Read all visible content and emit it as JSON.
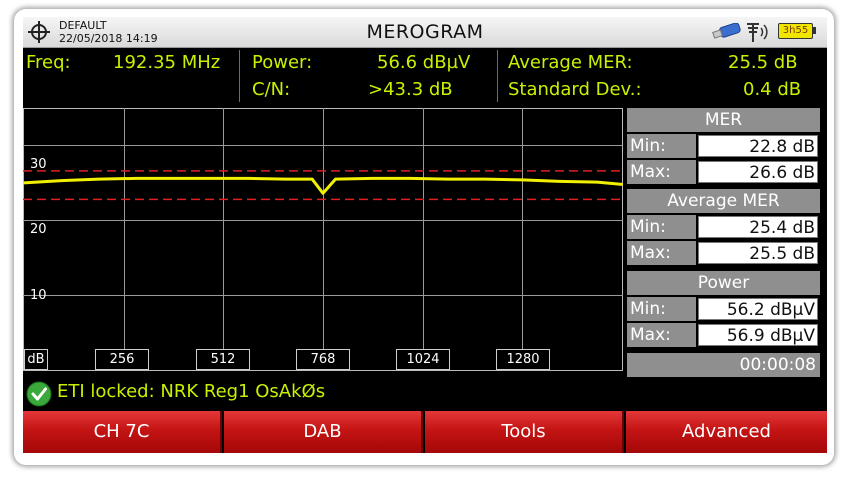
{
  "header": {
    "profile": "DEFAULT",
    "datetime": "22/05/2018 14:19",
    "title": "MEROGRAM",
    "battery_label": "3h55",
    "icons": [
      "crosshair-icon",
      "usb-icon",
      "antenna-signal-icon",
      "battery-icon"
    ]
  },
  "readouts": {
    "freq_label": "Freq:",
    "freq_value": "192.35 MHz",
    "power_label": "Power:",
    "power_value": "56.6 dBµV",
    "cn_label": "C/N:",
    "cn_value": ">43.3 dB",
    "avg_mer_label": "Average MER:",
    "avg_mer_value": "25.5 dB",
    "std_dev_label": "Standard Dev.:",
    "std_dev_value": "0.4 dB"
  },
  "chart_data": {
    "type": "line",
    "title": "",
    "xlabel": "",
    "ylabel": "dB",
    "x_ticks": [
      "256",
      "512",
      "768",
      "1024",
      "1280"
    ],
    "y_ticks": [
      "30",
      "20",
      "10"
    ],
    "y_unit_label": "dB",
    "xlim": [
      0,
      1536
    ],
    "ylim": [
      0,
      35
    ],
    "grid": true,
    "series": [
      {
        "color": "#f0f000",
        "x": [
          0,
          96,
          192,
          288,
          384,
          480,
          576,
          672,
          740,
          768,
          800,
          896,
          992,
          1088,
          1184,
          1280,
          1376,
          1472,
          1536
        ],
        "y": [
          25.0,
          25.3,
          25.5,
          25.6,
          25.6,
          25.6,
          25.6,
          25.5,
          25.5,
          23.6,
          25.5,
          25.6,
          25.6,
          25.5,
          25.5,
          25.4,
          25.2,
          25.1,
          24.8
        ]
      }
    ],
    "limit_lines": [
      {
        "color": "#e02020",
        "y": 26.6
      },
      {
        "color": "#e02020",
        "y": 22.8
      }
    ]
  },
  "stats": {
    "mer_header": "MER",
    "mer_min_label": "Min:",
    "mer_min_value": "22.8 dB",
    "mer_max_label": "Max:",
    "mer_max_value": "26.6 dB",
    "avg_header": "Average MER",
    "avg_min_label": "Min:",
    "avg_min_value": "25.4 dB",
    "avg_max_label": "Max:",
    "avg_max_value": "25.5 dB",
    "power_header": "Power",
    "power_min_label": "Min:",
    "power_min_value": "56.2 dBµV",
    "power_max_label": "Max:",
    "power_max_value": "56.9 dBµV",
    "timer": "00:00:08"
  },
  "status": {
    "text": "ETI locked: NRK Reg1 OsAkØs",
    "icon": "check-circle-icon"
  },
  "softkeys": [
    "CH 7C",
    "DAB",
    "Tools",
    "Advanced"
  ],
  "colors": {
    "readout_text": "#c8f000",
    "trace": "#f0f000",
    "limit": "#e02020",
    "softkey": "#c41414",
    "panel": "#8f8f8f"
  }
}
